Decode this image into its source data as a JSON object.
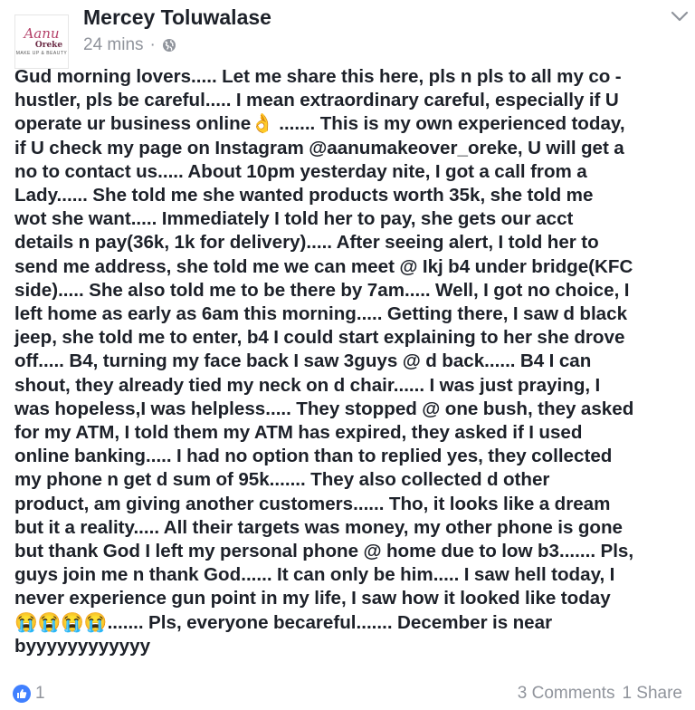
{
  "post": {
    "author": "Mercey Toluwalase",
    "time": "24 mins",
    "separator": "·",
    "privacy_icon": "globe-icon",
    "avatar": {
      "logo_script": "Aanu",
      "logo_name": "Oreke",
      "logo_tag": "MAKE UP & BEAUTY"
    },
    "lines": [
      "Gud morning lovers..... Let me share this here, pls n pls to all my co -",
      "hustler, pls be careful..... I mean extraordinary careful, especially if U",
      "operate ur business online👌 ....... This is my own experienced today,",
      "if U check my page on Instagram @aanumakeover_oreke, U will get a",
      "no to contact us..... About 10pm yesterday nite, I got a call from a",
      "Lady...... She told me she wanted products worth 35k, she told me",
      "wot she want..... Immediately I told her to pay, she gets our acct",
      "details n pay(36k, 1k for delivery)..... After seeing alert, I told her to",
      "send me address, she told me we can meet @ Ikj b4 under bridge(KFC",
      "side)..... She also told me to be there by 7am..... Well, I got no choice, I",
      "left home as early as 6am this morning..... Getting there, I saw d black",
      "jeep, she told me to enter, b4 I could start explaining to her she drove",
      "off..... B4, turning my face back I saw 3guys @ d back...... B4 I can",
      "shout, they already tied my neck on d chair...... I was just praying, I",
      "was hopeless,I was helpless..... They stopped @ one bush, they asked",
      "for my ATM, I told them my ATM has expired, they asked if I used",
      "online banking..... I had no option than to replied yes, they collected",
      "my phone n get d sum of 95k....... They also collected d other",
      "product, am giving another customers...... Tho, it looks like a dream",
      "but it a reality..... All their targets was money, my other phone is gone",
      "but thank God I left my personal phone @ home due to low b3....... Pls,",
      "guys join me n thank God...... It can only be him..... I saw hell today, I",
      "never experience gun point in my life, I saw how it looked like today",
      "😭😭😭😭....... Pls, everyone becareful....... December is near",
      "byyyyyyyyyyyy"
    ]
  },
  "footer": {
    "like_count": "1",
    "comments": "3 Comments",
    "shares": "1 Share"
  },
  "colors": {
    "accent": "#4080ff",
    "text": "#1d2129",
    "muted": "#90949c"
  }
}
